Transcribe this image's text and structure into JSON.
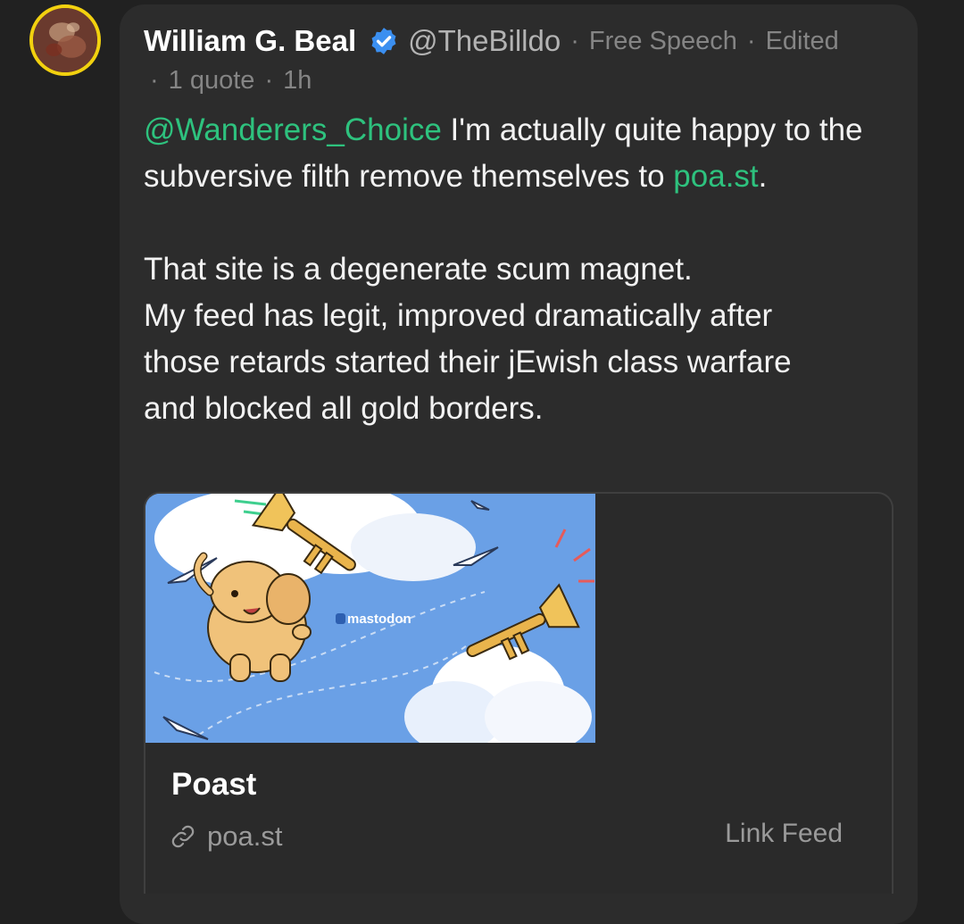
{
  "post": {
    "author_name": "William G. Beal",
    "handle": "@TheBilldo",
    "community": "Free Speech",
    "edited_label": "Edited",
    "quote_count": "1 quote",
    "time_ago": "1h",
    "mention": "@Wanderers_Choice",
    "text_after_mention": " I'm actually quite happy to the subversive filth remove themselves to ",
    "inline_link": "poa.st",
    "text_after_link": ".",
    "paragraph2_lines": [
      "That site is a degenerate scum magnet.",
      "My feed has legit, improved dramatically after",
      "those retards started their jEwish class warfare",
      "and blocked all gold borders."
    ]
  },
  "link_card": {
    "image_logo_text": "mastodon",
    "title": "Poast",
    "domain": "poa.st",
    "action_label": "Link Feed"
  },
  "icons": {
    "avatar": "avatar-image",
    "verified": "verified-badge-icon",
    "link": "link-chain-icon"
  },
  "colors": {
    "background": "#212121",
    "card": "#2c2c2c",
    "link": "#2ec27e",
    "verified": "#3b8ff0",
    "avatar_ring": "#f2d10f",
    "preview_bg": "#6aa0e6"
  }
}
